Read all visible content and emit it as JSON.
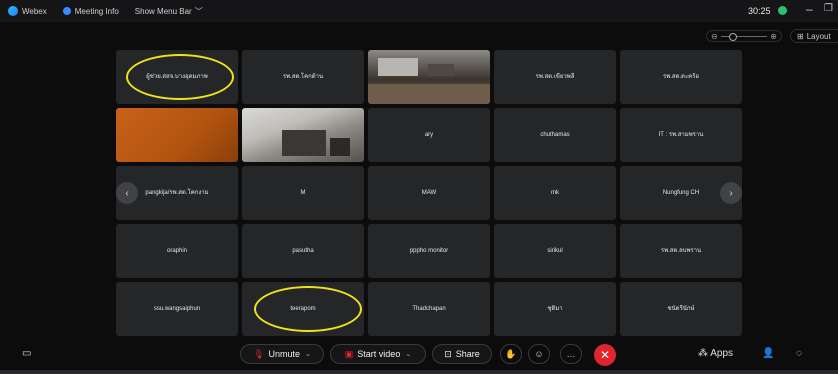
{
  "topbar": {
    "app": "Webex",
    "meeting_info": "Meeting Info",
    "show_menu": "Show Menu Bar",
    "time": "30:25"
  },
  "view": {
    "layout_label": "Layout"
  },
  "participants": [
    "ผู้ช่วย.สสจ.บางอุดมภาพ",
    "รพ.สต.โคกด้าน",
    "",
    "รพ.สต.เขียวพลี",
    "รพ.สต.ตะคร้อ",
    "",
    "",
    "ary",
    "chuthamas",
    "IT : รพ.สามพราน",
    "pangkija/รพ.สต.โคกงาม",
    "M",
    "MAW",
    "mk",
    "Nungfung CH",
    "oraphin",
    "pasutha",
    "pppho monitor",
    "sirikul",
    "รพ.สต.ลบพราน",
    "ssu.wangsaiphun",
    "teerapom",
    "Thadchapan",
    "ชุติมา",
    "ชนัดรีนักษ์"
  ],
  "circled_participants": [
    "ผู้ช่วย.สสจ.บางอุดมภาพ",
    "teerapom"
  ],
  "toolbar": {
    "unmute": "Unmute",
    "start_video": "Start video",
    "share": "Share",
    "apps": "Apps"
  },
  "colors": {
    "accent_red": "#e0252f",
    "highlight_yellow": "#f0e21b",
    "status_green": "#2fbf71"
  }
}
